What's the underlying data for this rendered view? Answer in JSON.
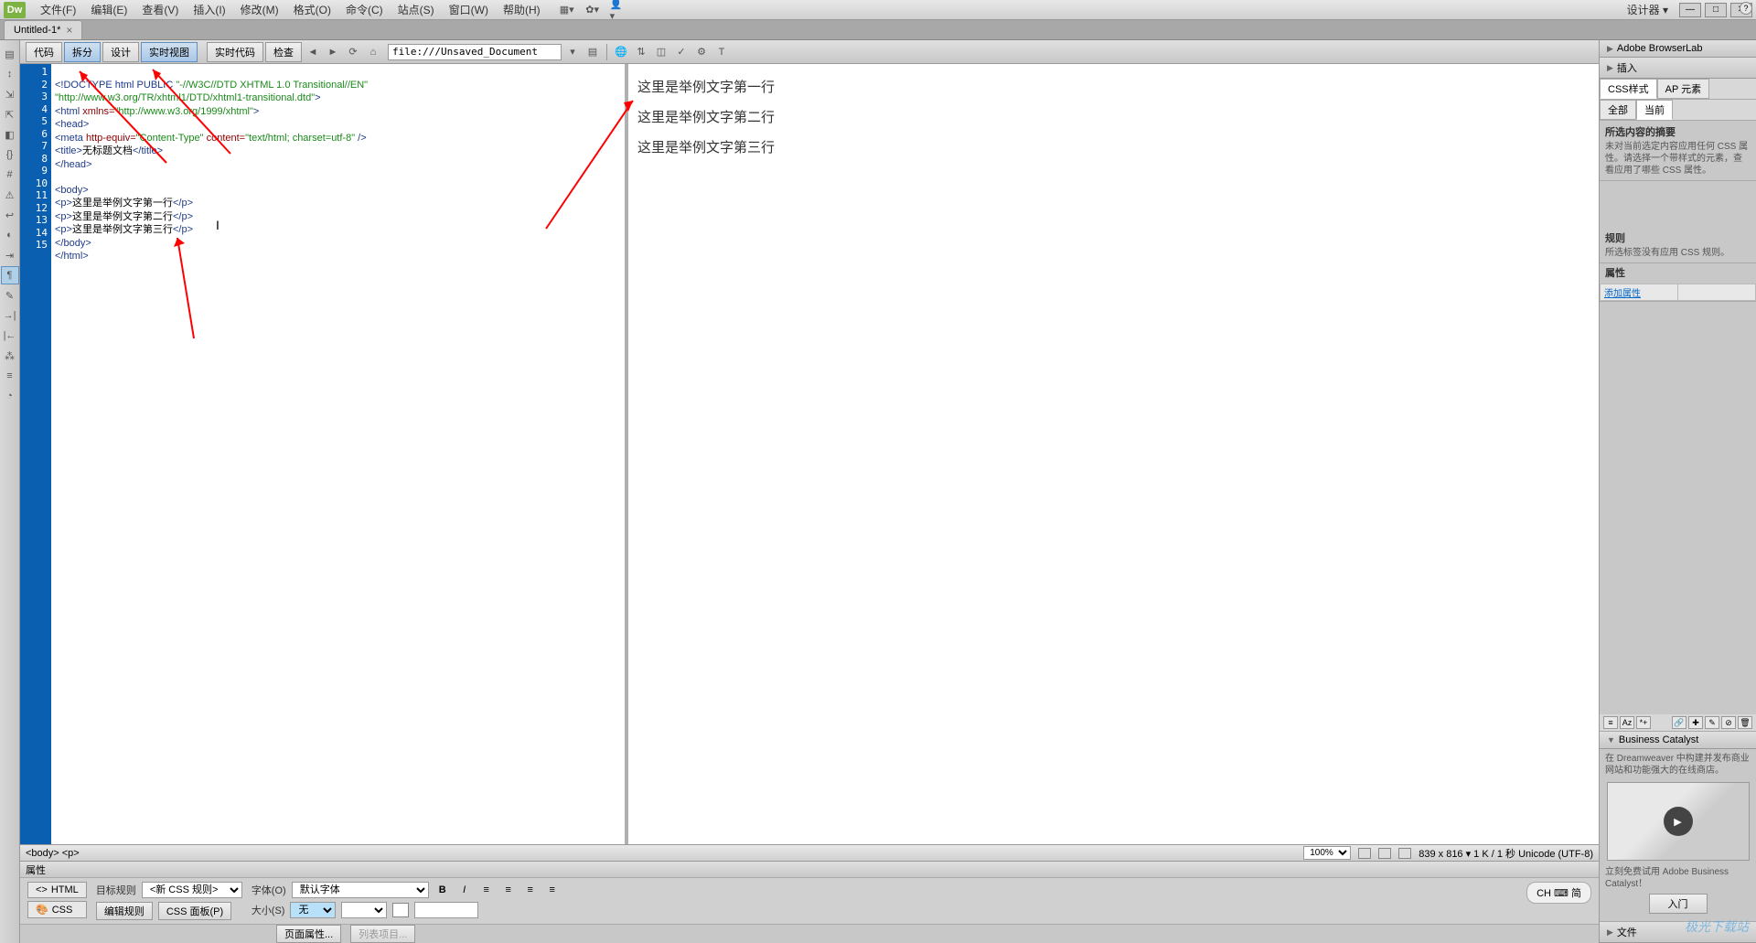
{
  "menubar": {
    "logo": "Dw",
    "items": [
      "文件(F)",
      "编辑(E)",
      "查看(V)",
      "插入(I)",
      "修改(M)",
      "格式(O)",
      "命令(C)",
      "站点(S)",
      "窗口(W)",
      "帮助(H)"
    ],
    "designer_label": "设计器 ▾"
  },
  "tabs": {
    "doc_name": "Untitled-1*"
  },
  "doc_toolbar": {
    "views": [
      "代码",
      "拆分",
      "设计",
      "实时视图"
    ],
    "active_view_index": 1,
    "buttons": [
      "实时代码",
      "检查"
    ],
    "address": "file:///Unsaved_Document"
  },
  "code": {
    "line_count": 15,
    "l1a": "<!DOCTYPE html PUBLIC ",
    "l1b": "\"-//W3C//DTD XHTML 1.0 Transitional//EN\"",
    "l2": "\"http://www.w3.org/TR/xhtml1/DTD/xhtml1-transitional.dtd\"",
    "l2b": ">",
    "l3a": "<html ",
    "l3b": "xmlns=",
    "l3c": "\"http://www.w3.org/1999/xhtml\"",
    "l3d": ">",
    "l4": "<head>",
    "l5a": "<meta ",
    "l5b": "http-equiv=",
    "l5c": "\"Content-Type\"",
    "l5d": " content=",
    "l5e": "\"text/html; charset=utf-8\"",
    "l5f": " />",
    "l6a": "<title>",
    "l6b": "无标题文档",
    "l6c": "</title>",
    "l7": "</head>",
    "l8": "",
    "l9": "<body>",
    "l10a": "<p>",
    "l10b": "这里是举例文字第一行",
    "l10c": "</p>",
    "l11a": "<p>",
    "l11b": "这里是举例文字第二行",
    "l11c": "</p>",
    "l12a": "<p>",
    "l12b": "这里是举例文字第三行",
    "l12c": "</p>",
    "l13": "</body>",
    "l14": "</html>",
    "l15": ""
  },
  "preview": {
    "p1": "这里是举例文字第一行",
    "p2": "这里是举例文字第二行",
    "p3": "这里是举例文字第三行"
  },
  "tag_selector": {
    "path": "<body> <p>",
    "zoom": "100%",
    "status": "839 x 816 ▾ 1 K / 1 秒 Unicode (UTF-8)"
  },
  "props": {
    "header": "属性",
    "html_btn": "HTML",
    "css_btn": "CSS",
    "target_rule_label": "目标规则",
    "target_rule_value": "<新 CSS 规则>",
    "edit_rule": "编辑规则",
    "css_panel": "CSS 面板(P)",
    "font_label": "字体(O)",
    "font_value": "默认字体",
    "size_label": "大小(S)",
    "size_value": "无",
    "page_props": "页面属性...",
    "list_item": "列表项目...",
    "ime": "CH ⌨ 简"
  },
  "right": {
    "browserlab": "Adobe BrowserLab",
    "insert": "插入",
    "css_styles": "CSS样式",
    "ap_elements": "AP 元素",
    "all": "全部",
    "current": "当前",
    "summary_title": "所选内容的摘要",
    "summary_text": "未对当前选定内容应用任何 CSS 属性。请选择一个带样式的元素，查看应用了哪些 CSS 属性。",
    "rules_title": "规则",
    "rules_text": "所选标签没有应用 CSS 规则。",
    "props_title": "属性",
    "add_prop": "添加属性",
    "bc_title": "Business Catalyst",
    "bc_text": "在 Dreamweaver 中构建并发布商业网站和功能强大的在线商店。",
    "bc_cta_text": "立刻免费试用 Adobe Business Catalyst！",
    "bc_btn": "入门",
    "files": "文件"
  },
  "watermark": "极光下载站"
}
